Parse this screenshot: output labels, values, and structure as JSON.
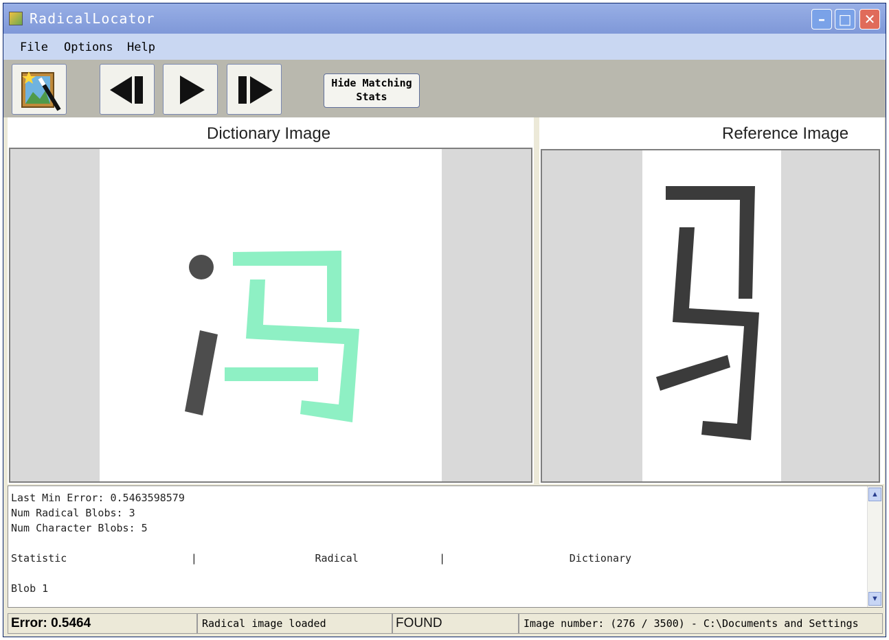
{
  "window": {
    "title": "RadicalLocator",
    "controls": {
      "minimize": "–",
      "maximize": "□",
      "close": "✕"
    }
  },
  "menu": {
    "items": [
      "File",
      "Options",
      "Help"
    ]
  },
  "toolbar": {
    "buttons": [
      {
        "name": "wizard-button",
        "icon": "wizard-icon"
      },
      {
        "name": "previous-button",
        "icon": "step-back-icon"
      },
      {
        "name": "play-button",
        "icon": "play-icon"
      },
      {
        "name": "next-button",
        "icon": "step-forward-icon"
      }
    ],
    "hide_stats_line1": "Hide Matching",
    "hide_stats_line2": "Stats"
  },
  "panels": {
    "dictionary_title": "Dictionary Image",
    "reference_title": "Reference Image"
  },
  "colors": {
    "radical_highlight": "#8ef0c4",
    "stroke_dark": "#4d4d4d",
    "reference_stroke": "#3b3b3b"
  },
  "stats": {
    "lines": [
      "Last Min Error: 0.5463598579",
      "Num Radical Blobs: 3",
      "Num Character Blobs: 5",
      "",
      "Statistic                    |                   Radical             |                    Dictionary",
      "",
      "Blob 1"
    ]
  },
  "status": {
    "error": "Error: 0.5464",
    "message": "Radical image loaded",
    "result": "FOUND",
    "image_info": "Image number:  (276 / 3500) - C:\\Documents and Settings"
  }
}
